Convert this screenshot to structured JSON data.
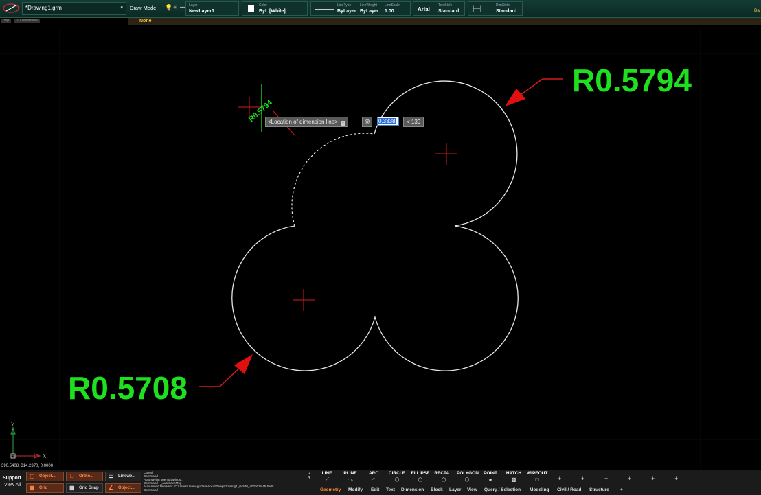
{
  "document": {
    "tab_title": "*Drawing1.grm"
  },
  "viewport_tags": [
    "Top",
    "2D Wireframe"
  ],
  "properties": {
    "draw_mode": "Draw Mode",
    "layer_label": "Layer",
    "layer_value": "NewLayer1",
    "color_label": "Color",
    "color_value": "ByL [White]",
    "linetype_label": "LineType",
    "linetype_value": "ByLayer",
    "lineweight_label": "LineWeight",
    "lineweight_value": "ByLayer",
    "linescale_label": "LineScale",
    "linescale_value": "1.00",
    "font_value": "Arial",
    "textstyle_label": "TextStyle",
    "textstyle_value": "Standard",
    "dimstyle_label": "DimStyle",
    "dimstyle_value": "Standard",
    "right_label": "Ba"
  },
  "subbar": {
    "value": "None"
  },
  "canvas": {
    "annotation_top": "R0.5794",
    "annotation_bottom": "R0.5708",
    "dim_preview_text": "R0.5794",
    "tooltip_text": "<Location of dimension line>",
    "at_symbol": "@",
    "dim_input_value": "0.3338",
    "angle_text": "< 139",
    "ucs_y": "Y",
    "ucs_x": "X"
  },
  "status": {
    "coordinates": "390.5408, 314.2370, 0.0000",
    "support_label": "Support",
    "view_all_label": "View All",
    "buttons": [
      {
        "label": "Object...",
        "active": true
      },
      {
        "label": "Ortho...",
        "active": true
      },
      {
        "label": "Linewe...",
        "active": false
      },
      {
        "label": "Grid",
        "active": true
      },
      {
        "label": "Grid Snap",
        "active": false
      },
      {
        "label": "Object...",
        "active": true
      }
    ]
  },
  "command_log": [
    "Cancel",
    "Command :",
    "Auto saving open drawings...",
    "Command : _AutoSaveMsg",
    "Auto saved filename : 'C:\\Users\\User\\AppData\\Local\\Temp\\Drawing1_04570_a02bb1fd45.SVS'",
    "Command :"
  ],
  "ribbon": {
    "tools": [
      "LINE",
      "PLINE",
      "ARC",
      "CIRCLE",
      "ELLIPSE",
      "RECTA...",
      "POLYGON",
      "POINT",
      "HATCH",
      "WIPEOUT"
    ],
    "tabs": [
      "Geometry",
      "Modify",
      "Edit",
      "Text",
      "Dimension",
      "Block",
      "Layer",
      "View",
      "Query / Selection",
      "Modeling",
      "Civil / Road",
      "Structure"
    ],
    "active_tab": "Geometry",
    "plus": "+"
  },
  "colors": {
    "annotation": "#1fe01f",
    "arrow": "#e01010",
    "accent": "#ff8a3a"
  }
}
